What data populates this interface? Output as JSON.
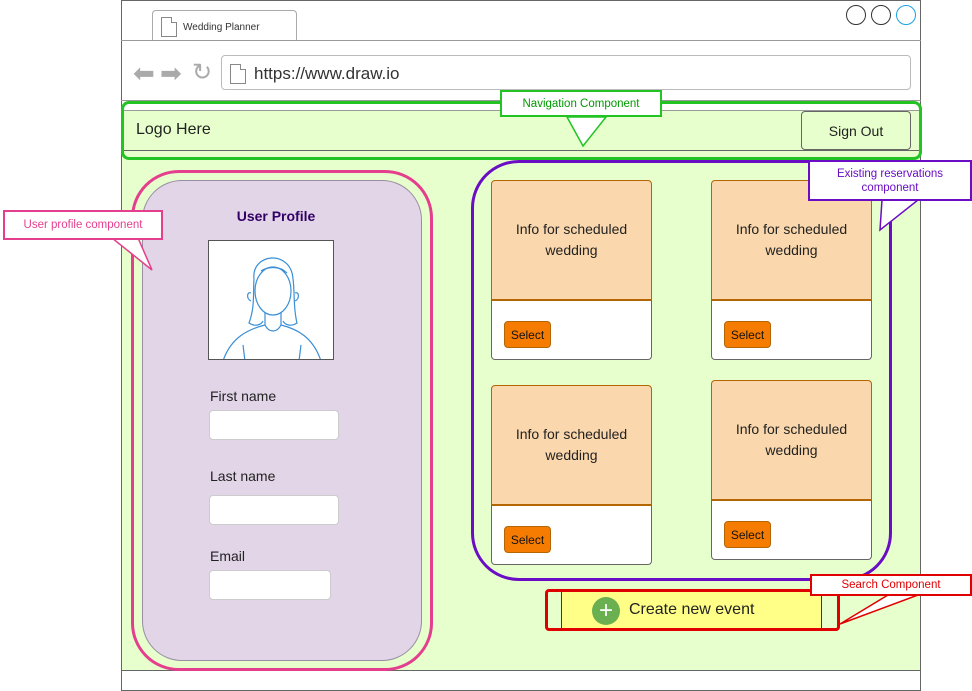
{
  "browser": {
    "tab_title": "Wedding Planner",
    "url": "https://www.draw.io",
    "back_icon": "back-arrow-icon",
    "forward_icon": "forward-arrow-icon",
    "reload_icon": "reload-icon"
  },
  "nav": {
    "logo": "Logo Here",
    "sign_out": "Sign Out"
  },
  "profile": {
    "title": "User Profile",
    "fields": [
      {
        "label": "First name",
        "value": ""
      },
      {
        "label": "Last name",
        "value": ""
      },
      {
        "label": "Email",
        "value": ""
      }
    ]
  },
  "reservations": [
    {
      "info": "Info for scheduled wedding",
      "select": "Select"
    },
    {
      "info": "Info for scheduled wedding",
      "select": "Select"
    },
    {
      "info": "Info for scheduled wedding",
      "select": "Select"
    },
    {
      "info": "Info for scheduled wedding",
      "select": "Select"
    }
  ],
  "search": {
    "create_label": "Create new event",
    "icon": "plus-circle-icon"
  },
  "callouts": {
    "navigation": "Navigation Component",
    "user_profile": "User profile component",
    "reservations": "Existing reservations component",
    "search": "Search Component"
  },
  "colors": {
    "background": "#e6ffcc",
    "profile": "#e1d5e7",
    "card": "#fad7ac",
    "select_button": "#f57c00",
    "create_button": "#ffff88",
    "navigation_highlight": "#22c322",
    "profile_highlight": "#e43f8e",
    "reservations_highlight": "#6a0dc4",
    "search_highlight": "#e00000"
  }
}
